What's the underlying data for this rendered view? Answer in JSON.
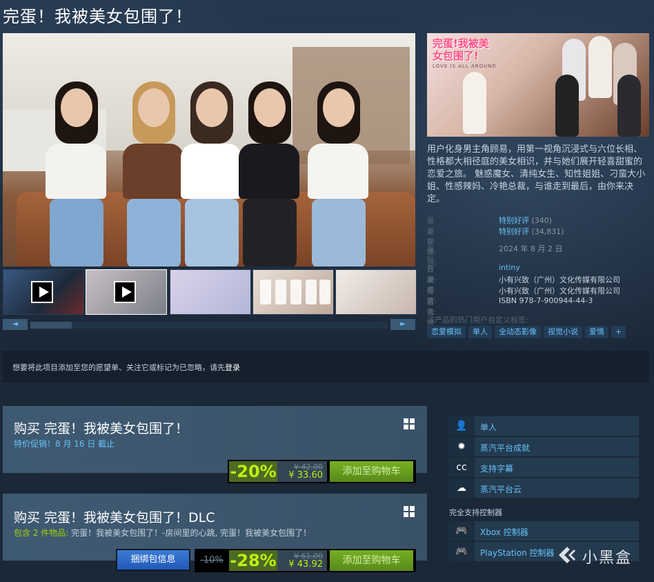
{
  "title": "完蛋！我被美女包围了！",
  "capsule": {
    "logo_text": "完蛋!我被美女包围了!",
    "logo_sub": "LOVE IS ALL AROUND"
  },
  "description": "用户化身男主角顾易，用第一视角沉浸式与六位长相、性格都大相径庭的美女相识，并与她们展开轻喜甜蜜的恋爱之旅。 魅惑魔女、清纯女生、知性姐姐、刁蛮大小姐、性感辣妈、冷艳总裁，与谁走到最后，由你来决定。",
  "reviews": {
    "recent_label": "最近评测:",
    "recent_value": "特别好评",
    "recent_count": "(340)",
    "all_label": "全部评测:",
    "all_value": "特别好评",
    "all_count": "(34,831)"
  },
  "release": {
    "label": "发行日期:",
    "value": "2024 年 8 月 2 日"
  },
  "developer": {
    "label": "开发商:",
    "value": "intiny"
  },
  "publisher": {
    "label": "发行商:",
    "value": "小有兴致（广州）文化传媒有限公司"
  },
  "operator": {
    "label": "运营商:",
    "value": "小有兴致（广州）文化传媒有限公司"
  },
  "isbn": {
    "label": "出版物号:",
    "value": "ISBN 978-7-900944-44-3"
  },
  "tags_label": "该产品的热门用户自定义标签:",
  "tags": [
    "恋爱模拟",
    "单人",
    "全动态影像",
    "视觉小说",
    "爱情",
    "+"
  ],
  "slider": {
    "left_arrow": "◄",
    "right_arrow": "►"
  },
  "login_notice": {
    "text": "想要将此项目添加至您的愿望单、关注它或标记为已忽略，请先",
    "link": "登录"
  },
  "purchase": [
    {
      "title": "购买 完蛋！我被美女包围了！",
      "note": "特价促销！8 月 16 日 截止",
      "discount": "-20%",
      "original_price": "¥ 42.00",
      "final_price": "¥ 33.60",
      "cart_label": "添加至购物车"
    },
    {
      "title": "购买 完蛋！我被美女包围了！DLC",
      "note_prefix": "包含 2 件物品:",
      "note_items": " 完蛋！我被美女包围了！-房间里的心跳, 完蛋！我被美女包围了！",
      "bundle_info_label": "捆绑包信息",
      "group_discount": "-10%",
      "discount": "-28%",
      "original_price": "¥ 61.00",
      "final_price": "¥ 43.92",
      "cart_label": "添加至购物车"
    }
  ],
  "features": [
    {
      "icon": "single-player-icon",
      "glyph": "👤",
      "label": "单人"
    },
    {
      "icon": "achievements-icon",
      "glyph": "✹",
      "label": "蒸汽平台成就"
    },
    {
      "icon": "captions-icon",
      "glyph": "cc",
      "label": "支持字幕"
    },
    {
      "icon": "cloud-icon",
      "glyph": "☁",
      "label": "蒸汽平台云"
    }
  ],
  "controller_heading": "完全支持控制器",
  "controllers": [
    {
      "icon": "xbox-controller-icon",
      "glyph": "🎮",
      "label": "Xbox 控制器"
    },
    {
      "icon": "playstation-controller-icon",
      "glyph": "🎮",
      "label": "PlayStation 控制器"
    }
  ],
  "watermark": "小黑盒",
  "colors": {
    "background": "#1b2838",
    "link": "#66c0f4",
    "discount_text": "#beee11",
    "discount_bg": "#4c6b22",
    "cart_green": "#75b022"
  }
}
